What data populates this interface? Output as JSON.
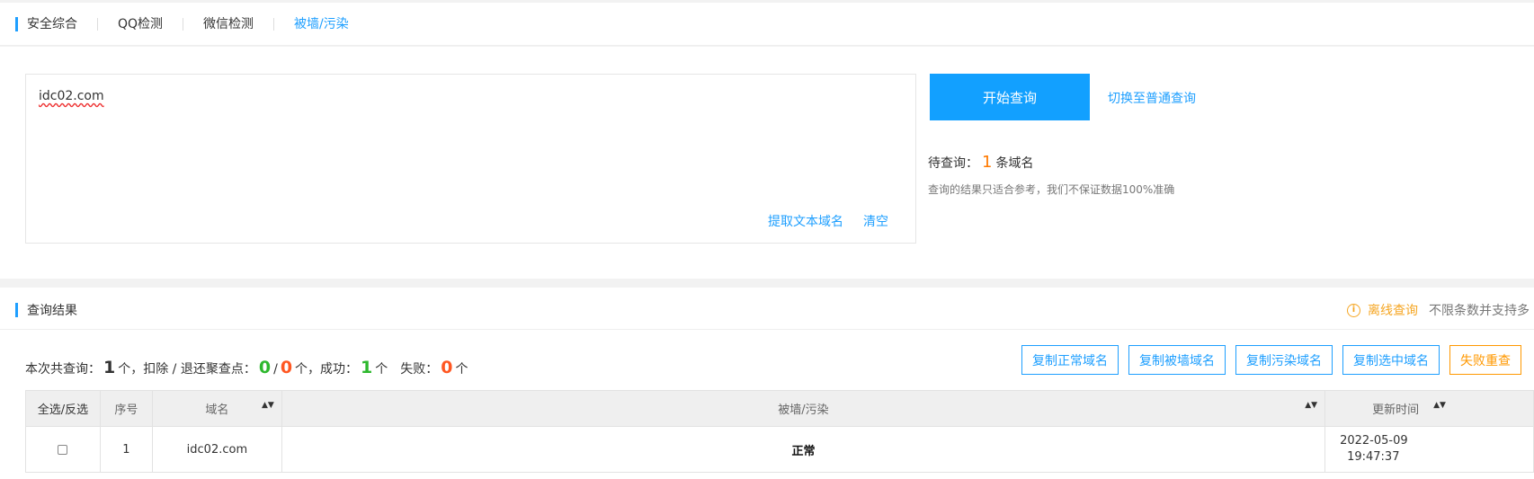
{
  "tabs": [
    "安全综合",
    "QQ检测",
    "微信检测",
    "被墙/污染"
  ],
  "query": {
    "input_value": "idc02.com",
    "extract_link": "提取文本域名",
    "clear_link": "清空",
    "start_button": "开始查询",
    "switch_link": "切换至普通查询",
    "pending_prefix": "待查询：",
    "pending_count": "1",
    "pending_suffix": "条域名",
    "note": "查询的结果只适合参考，我们不保证数据100%准确"
  },
  "results": {
    "title": "查询结果",
    "offline_link": "离线查询",
    "offline_desc": "不限条数并支持多",
    "summary": {
      "prefix": "本次共查询：",
      "total": "1",
      "deduct_label": "个，扣除 / 退还聚查点：",
      "deduct": "0",
      "slash": "/",
      "refund": "0",
      "success_label": "个，成功：",
      "success": "1",
      "fail_label": "个　失败：",
      "fail": "0",
      "unit": "个"
    },
    "actions": [
      "复制正常域名",
      "复制被墙域名",
      "复制污染域名",
      "复制选中域名",
      "失败重查"
    ],
    "columns": [
      "全选/反选",
      "序号",
      "域名",
      "被墙/污染",
      "更新时间"
    ],
    "rows": [
      {
        "index": "1",
        "domain": "idc02.com",
        "status": "正常",
        "date": "2022-05-09",
        "time": "19:47:37"
      }
    ]
  },
  "colors": {
    "accent": "#1e9fff",
    "primary_button": "#12a0ff",
    "warning": "#ff9800",
    "success": "#2eb82e",
    "danger": "#ff5722"
  }
}
